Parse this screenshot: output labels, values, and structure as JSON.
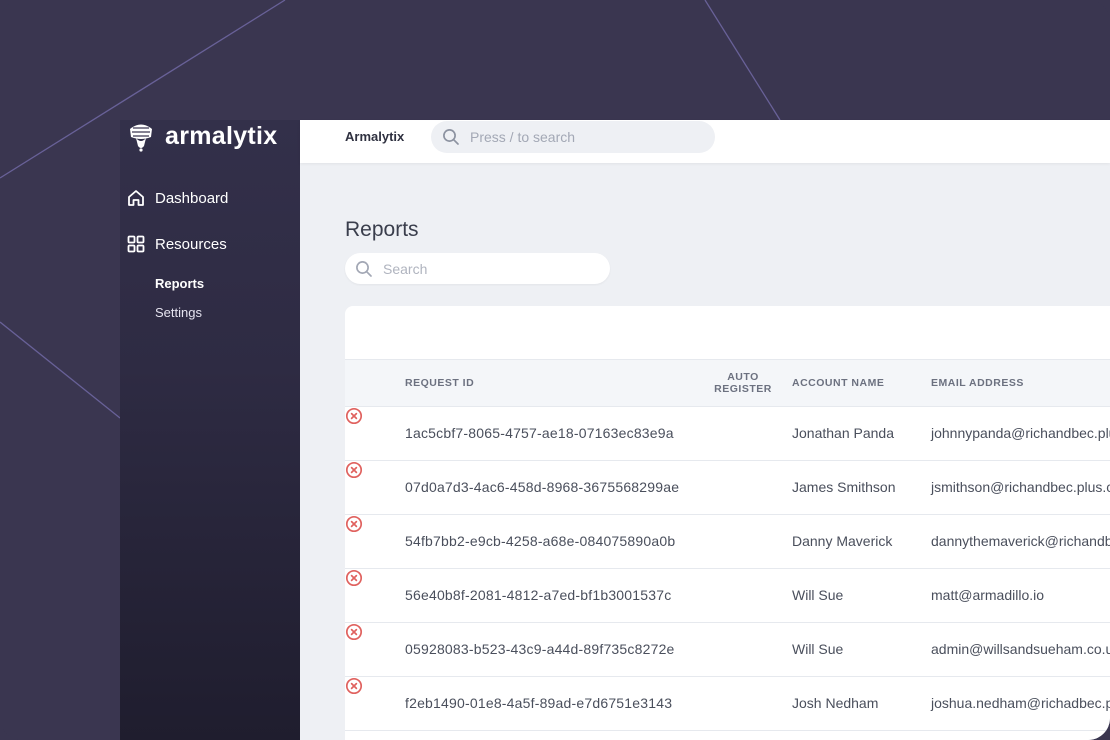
{
  "sidebar": {
    "logo_text": "armalytix",
    "nav": [
      {
        "label": "Dashboard",
        "icon": "home-icon"
      },
      {
        "label": "Resources",
        "icon": "grid-icon"
      }
    ],
    "sub_items": [
      {
        "label": "Reports",
        "active": true
      },
      {
        "label": "Settings",
        "active": false
      }
    ]
  },
  "topbar": {
    "brand": "Armalytix",
    "search_placeholder": "Press / to search"
  },
  "page": {
    "title": "Reports",
    "search_placeholder": "Search"
  },
  "table": {
    "columns": {
      "request_id": "REQUEST ID",
      "auto_register_line1": "AUTO",
      "auto_register_line2": "REGISTER",
      "account_name": "ACCOUNT NAME",
      "email": "EMAIL ADDRESS"
    },
    "rows": [
      {
        "request_id": "1ac5cbf7-8065-4757-ae18-07163ec83e9a",
        "auto_register": false,
        "account": "Jonathan Panda",
        "email": "johnnypanda@richandbec.plu"
      },
      {
        "request_id": "07d0a7d3-4ac6-458d-8968-3675568299ae",
        "auto_register": false,
        "account": "James Smithson",
        "email": "jsmithson@richandbec.plus.c"
      },
      {
        "request_id": "54fb7bb2-e9cb-4258-a68e-084075890a0b",
        "auto_register": false,
        "account": "Danny Maverick",
        "email": "dannythemaverick@richandb"
      },
      {
        "request_id": "56e40b8f-2081-4812-a7ed-bf1b3001537c",
        "auto_register": false,
        "account": "Will Sue",
        "email": "matt@armadillo.io"
      },
      {
        "request_id": "05928083-b523-43c9-a44d-89f735c8272e",
        "auto_register": false,
        "account": "Will Sue",
        "email": "admin@willsandsueham.co.u"
      },
      {
        "request_id": "f2eb1490-01e8-4a5f-89ad-e7d6751e3143",
        "auto_register": false,
        "account": "Josh Nedham",
        "email": "joshua.nedham@richadbec.p"
      }
    ]
  },
  "colors": {
    "background": "#3a3650",
    "sidebar": "#2e2b43",
    "accent_line": "#6e66a0",
    "error_icon": "#e0625f"
  }
}
